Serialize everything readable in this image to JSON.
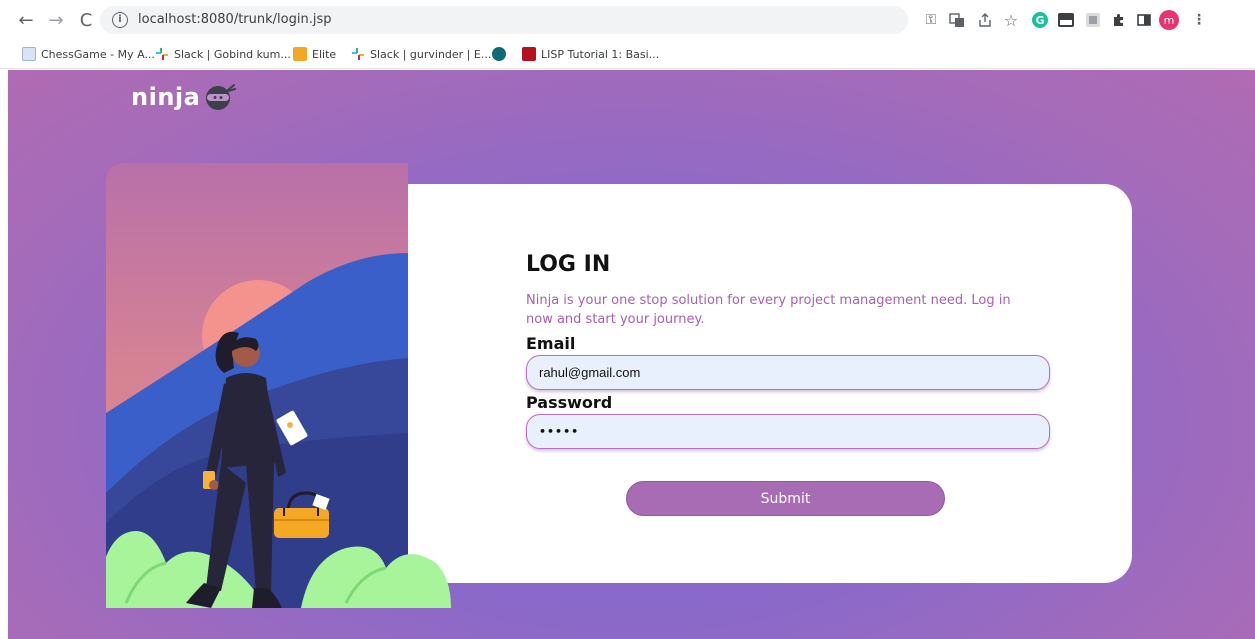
{
  "browser": {
    "url": "localhost:8080/trunk/login.jsp",
    "profile_initial": "m",
    "bookmarks": [
      {
        "label": "ChessGame - My A..."
      },
      {
        "label": "Slack | Gobind kum..."
      },
      {
        "label": "Elite"
      },
      {
        "label": "Slack | gurvinder | E..."
      },
      {
        "label": ""
      },
      {
        "label": "LISP Tutorial 1: Basi..."
      }
    ]
  },
  "header": {
    "brand": "ninja"
  },
  "login": {
    "title": "LOG IN",
    "description": "Ninja is your one stop solution for every project management need. Log in now and start your journey.",
    "email_label": "Email",
    "email_value": "rahul@gmail.com",
    "password_label": "Password",
    "password_value": "•••••",
    "submit_label": "Submit"
  },
  "colors": {
    "accent": "#a86cb5",
    "description_text": "#a960b0",
    "input_bg": "#e8effd"
  }
}
